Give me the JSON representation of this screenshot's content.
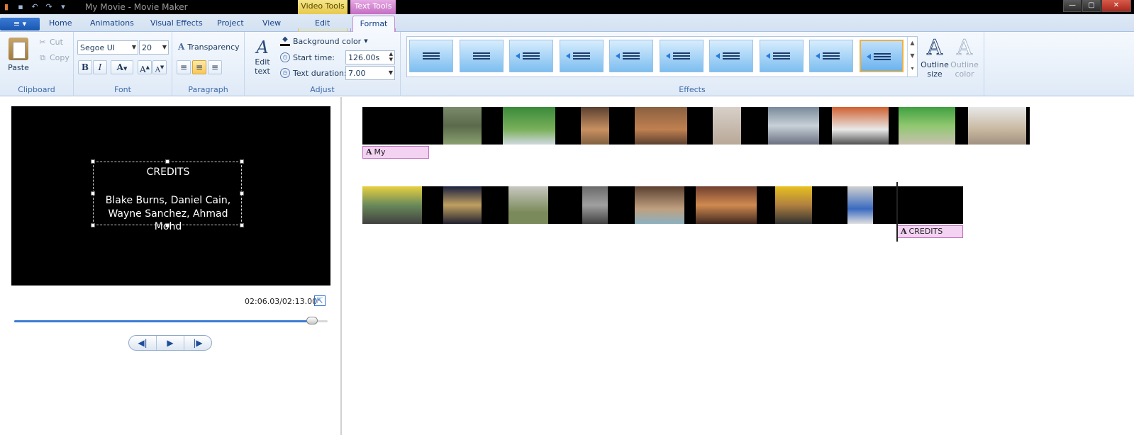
{
  "window": {
    "title": "My Movie - Movie Maker",
    "context_tabs": {
      "video_tools": "Video Tools",
      "text_tools": "Text Tools"
    },
    "controls": {
      "minimize": "—",
      "maximize": "▢",
      "close": "✕"
    }
  },
  "quick_access": {
    "save": "▪",
    "undo": "↶",
    "redo": "↷",
    "customize": "▾"
  },
  "tabs": {
    "file": "≡ ▾",
    "home": "Home",
    "animations": "Animations",
    "visual_effects": "Visual Effects",
    "project": "Project",
    "view": "View",
    "edit": "Edit",
    "format": "Format",
    "help": "?"
  },
  "ribbon": {
    "clipboard": {
      "label": "Clipboard",
      "paste": "Paste",
      "cut": "Cut",
      "copy": "Copy"
    },
    "font": {
      "label": "Font",
      "family": "Segoe UI",
      "size": "20",
      "bold": "B",
      "italic": "I",
      "color": "A",
      "grow": "A",
      "shrink": "A"
    },
    "paragraph": {
      "label": "Paragraph",
      "transparency": "Transparency"
    },
    "adjust": {
      "label": "Adjust",
      "edit_text": "Edit text",
      "background_color": "Background color",
      "start_time_label": "Start time:",
      "start_time_value": "126.00s",
      "text_duration_label": "Text duration:",
      "text_duration_value": "7.00"
    },
    "effects": {
      "label": "Effects",
      "selected_index": 9,
      "count": 10,
      "outline_size": "Outline size",
      "outline_color": "Outline color"
    }
  },
  "preview": {
    "text_line1": "CREDITS",
    "text_line2": "Blake Burns, Daniel Cain,",
    "text_line3": "Wayne Sanchez, Ahmad Mohd",
    "timecode": "02:06.03/02:13.00",
    "progress": 0.9496,
    "buttons": {
      "prev": "◀|",
      "play": "▶",
      "next": "|▶"
    }
  },
  "storyboard": {
    "row1_caption": "My",
    "row2_caption": "CREDITS",
    "caption_icon": "A"
  },
  "colors": {
    "accent": "#3a7bd5",
    "caption_bg": "#f3d2f2",
    "video_tools": "#e7c94c",
    "text_tools": "#c46ec2"
  }
}
